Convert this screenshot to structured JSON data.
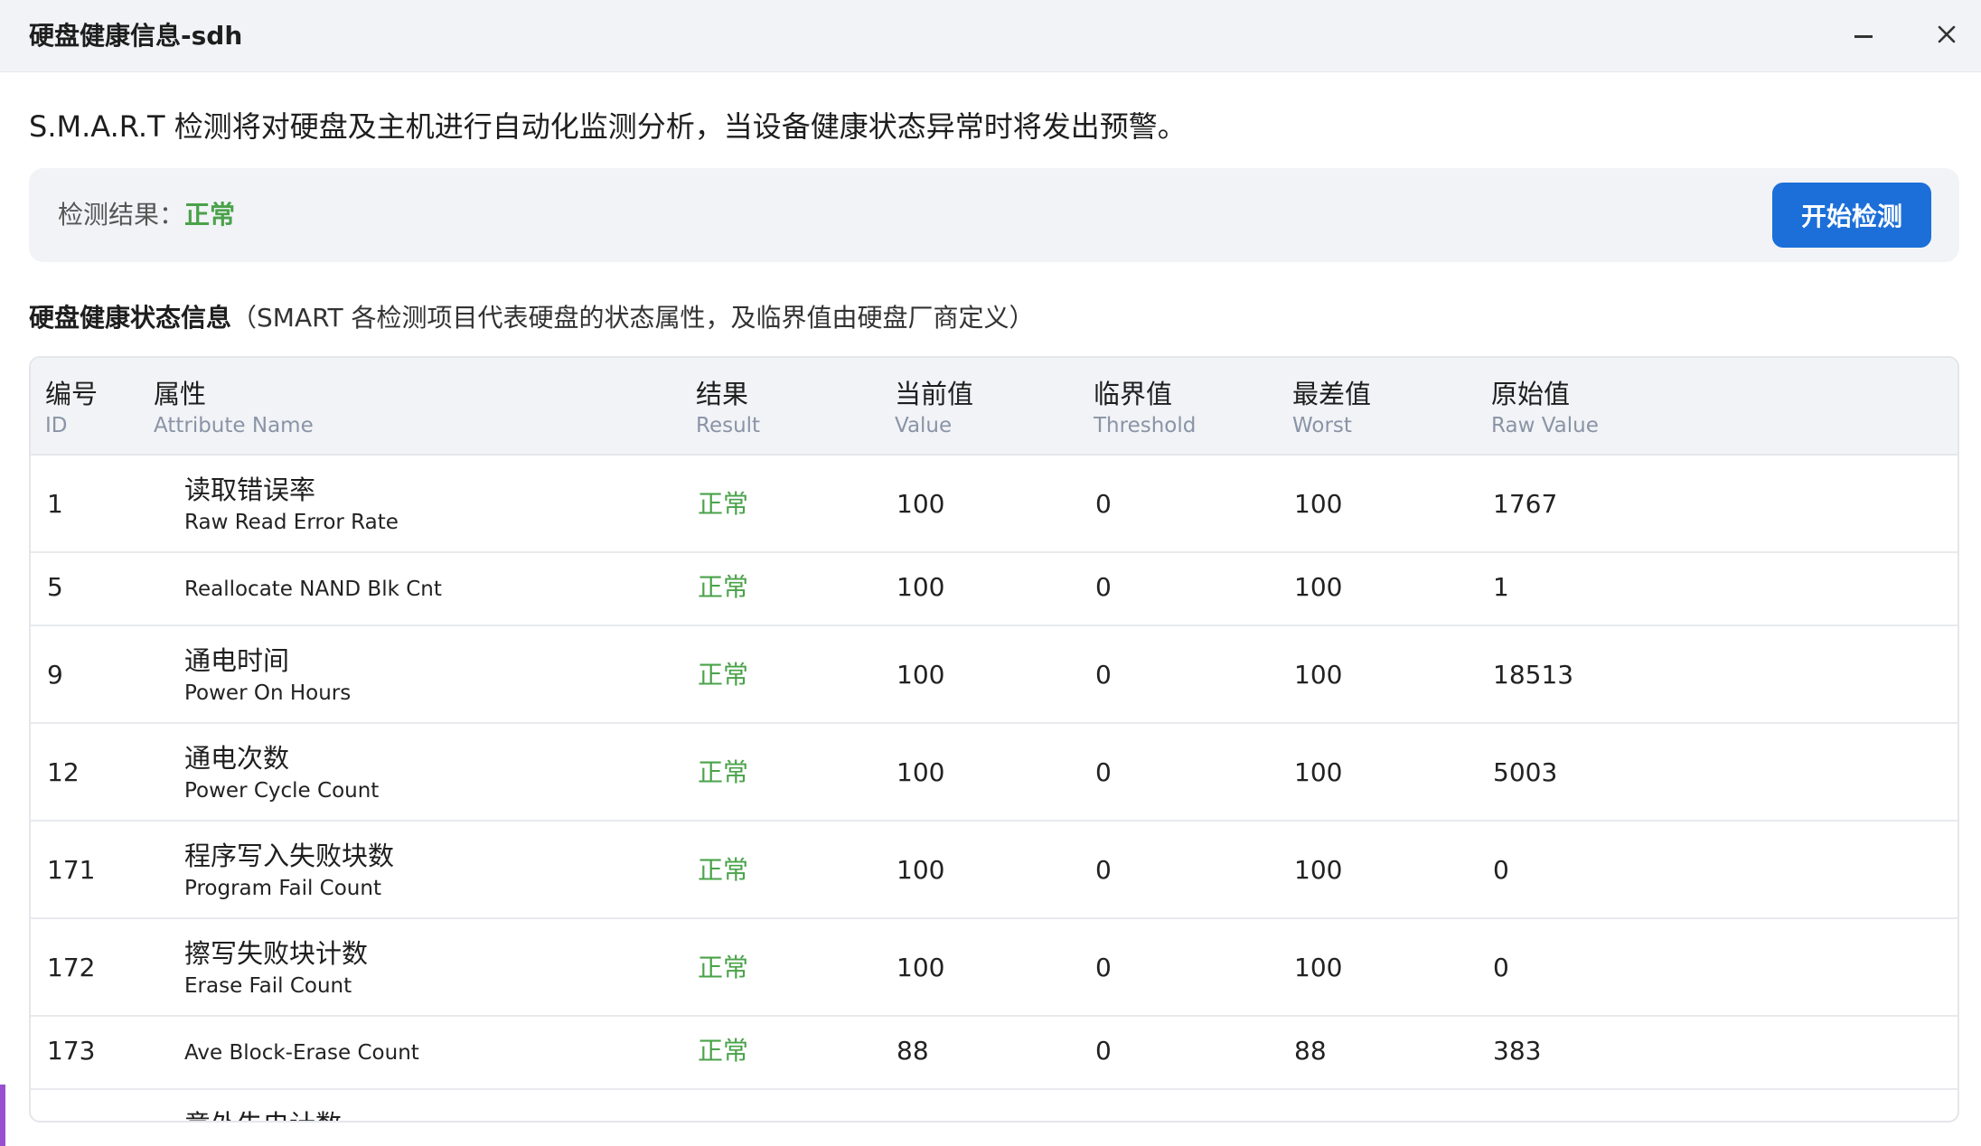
{
  "window": {
    "title": "硬盘健康信息-sdh",
    "minimize_icon": "minimize-icon",
    "close_icon": "close-icon"
  },
  "intro": "S.M.A.R.T 检测将对硬盘及主机进行自动化监测分析，当设备健康状态异常时将发出预警。",
  "result": {
    "label": "检测结果：",
    "value": "正常",
    "value_color": "#4aa24a",
    "button_label": "开始检测",
    "button_color": "#1c6fd9"
  },
  "section": {
    "title": "硬盘健康状态信息",
    "note": "（SMART 各检测项目代表硬盘的状态属性，及临界值由硬盘厂商定义）"
  },
  "table": {
    "columns": [
      {
        "zh": "编号",
        "en": "ID"
      },
      {
        "zh": "属性",
        "en": "Attribute Name"
      },
      {
        "zh": "结果",
        "en": "Result"
      },
      {
        "zh": "当前值",
        "en": "Value"
      },
      {
        "zh": "临界值",
        "en": "Threshold"
      },
      {
        "zh": "最差值",
        "en": "Worst"
      },
      {
        "zh": "原始值",
        "en": "Raw Value"
      }
    ],
    "rows": [
      {
        "id": "1",
        "name_zh": "读取错误率",
        "name_en": "Raw Read Error Rate",
        "result": "正常",
        "value": "100",
        "threshold": "0",
        "worst": "100",
        "raw": "1767"
      },
      {
        "id": "5",
        "name_zh": "",
        "name_en": "Reallocate NAND Blk Cnt",
        "result": "正常",
        "value": "100",
        "threshold": "0",
        "worst": "100",
        "raw": "1"
      },
      {
        "id": "9",
        "name_zh": "通电时间",
        "name_en": "Power On Hours",
        "result": "正常",
        "value": "100",
        "threshold": "0",
        "worst": "100",
        "raw": "18513"
      },
      {
        "id": "12",
        "name_zh": "通电次数",
        "name_en": "Power Cycle Count",
        "result": "正常",
        "value": "100",
        "threshold": "0",
        "worst": "100",
        "raw": "5003"
      },
      {
        "id": "171",
        "name_zh": "程序写入失败块数",
        "name_en": "Program Fail Count",
        "result": "正常",
        "value": "100",
        "threshold": "0",
        "worst": "100",
        "raw": "0"
      },
      {
        "id": "172",
        "name_zh": "擦写失败块计数",
        "name_en": "Erase Fail Count",
        "result": "正常",
        "value": "100",
        "threshold": "0",
        "worst": "100",
        "raw": "0"
      },
      {
        "id": "173",
        "name_zh": "",
        "name_en": "Ave Block-Erase Count",
        "result": "正常",
        "value": "88",
        "threshold": "0",
        "worst": "88",
        "raw": "383"
      },
      {
        "id": "",
        "name_zh": "意外失电计数",
        "name_en": "",
        "result": "",
        "value": "",
        "threshold": "",
        "worst": "",
        "raw": ""
      }
    ]
  }
}
